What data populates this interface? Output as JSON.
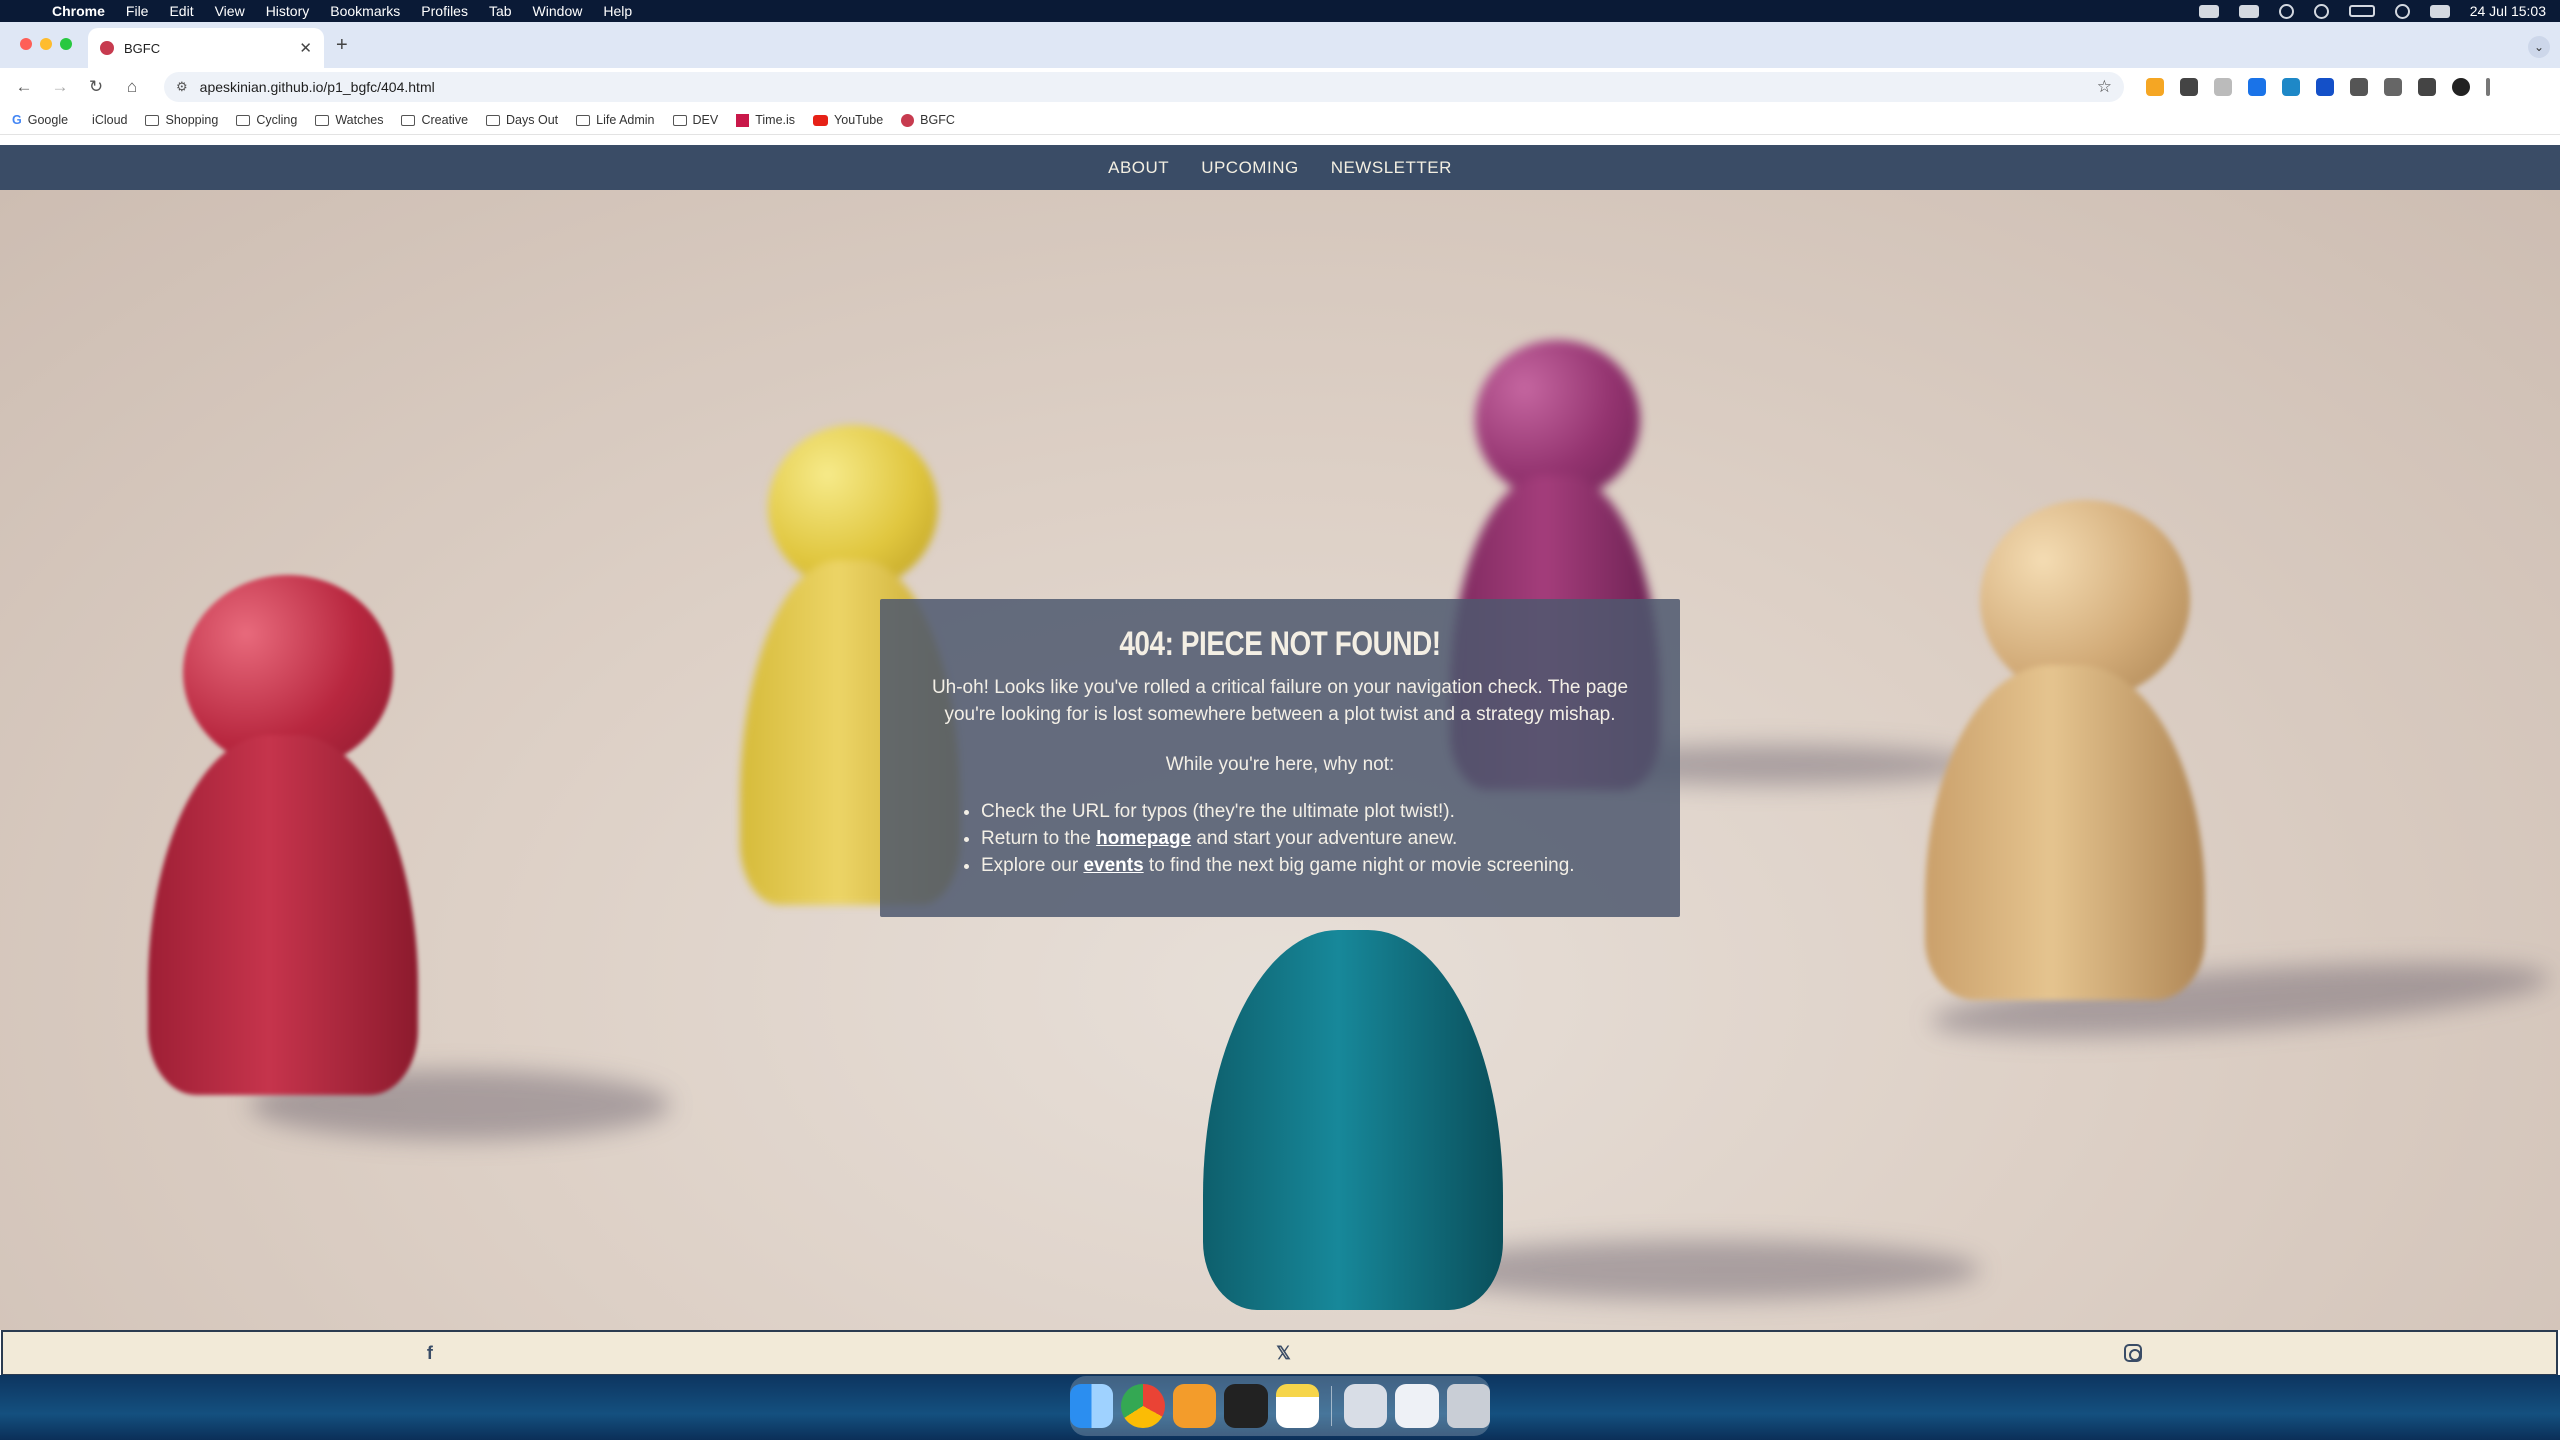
{
  "menubar": {
    "app": "Chrome",
    "items": [
      "File",
      "Edit",
      "View",
      "History",
      "Bookmarks",
      "Profiles",
      "Tab",
      "Window",
      "Help"
    ],
    "clock": "24 Jul  15:03"
  },
  "browser": {
    "tab_title": "BGFC",
    "url": "apeskinian.github.io/p1_bgfc/404.html",
    "bookmarks": [
      {
        "label": "Google",
        "icon": "google-icon"
      },
      {
        "label": "iCloud",
        "icon": "apple-icon"
      },
      {
        "label": "Shopping",
        "icon": "folder-icon"
      },
      {
        "label": "Cycling",
        "icon": "folder-icon"
      },
      {
        "label": "Watches",
        "icon": "folder-icon"
      },
      {
        "label": "Creative",
        "icon": "folder-icon"
      },
      {
        "label": "Days Out",
        "icon": "folder-icon"
      },
      {
        "label": "Life Admin",
        "icon": "folder-icon"
      },
      {
        "label": "DEV",
        "icon": "folder-icon"
      },
      {
        "label": "Time.is",
        "icon": "timeis-icon"
      },
      {
        "label": "YouTube",
        "icon": "youtube-icon"
      },
      {
        "label": "BGFC",
        "icon": "bgfc-icon"
      }
    ]
  },
  "site": {
    "nav": [
      "ABOUT",
      "UPCOMING",
      "NEWSLETTER"
    ],
    "error": {
      "title": "404: PIECE NOT FOUND!",
      "intro": "Uh-oh! Looks like you've rolled a critical failure on your navigation check. The page you're looking for is lost somewhere between a plot twist and a strategy mishap.",
      "why": "While you're here, why not:",
      "item1": "Check the URL for typos (they're the ultimate plot twist!).",
      "item2_pre": "Return to the ",
      "item2_link": "homepage",
      "item2_post": " and start your adventure anew.",
      "item3_pre": "Explore our ",
      "item3_link": "events",
      "item3_post": " to find the next big game night or movie screening."
    },
    "footer_icons": [
      "facebook-icon",
      "x-icon",
      "instagram-icon"
    ]
  },
  "colors": {
    "nav_bg": "#3a4c66",
    "panel_bg": "#4e586e",
    "footer_bg": "#f2ead8"
  }
}
